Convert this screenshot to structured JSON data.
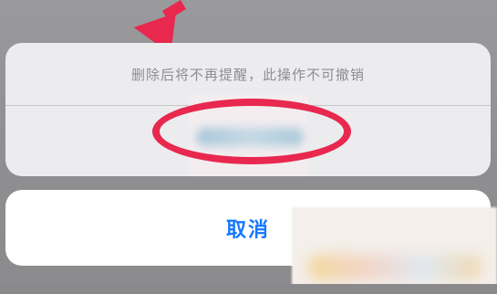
{
  "action_sheet": {
    "message": "删除后将不再提醒，此操作不可撤销",
    "delete_label": ""
  },
  "cancel": {
    "label": "取消"
  },
  "colors": {
    "accent_blue": "#1677ff",
    "annotation_red": "#e8284e",
    "message_gray": "#8d8d92"
  }
}
